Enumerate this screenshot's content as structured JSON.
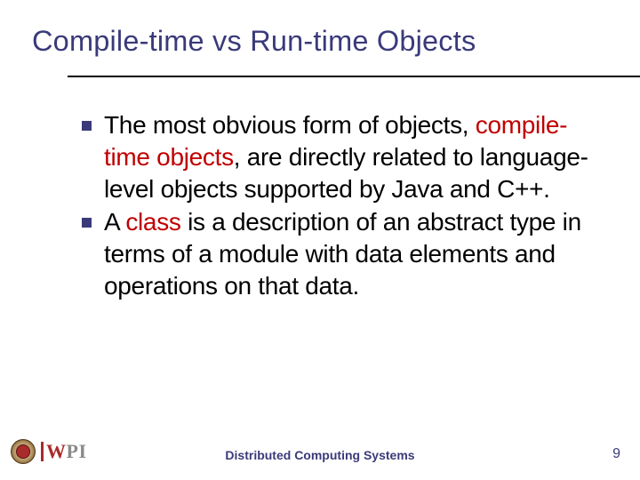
{
  "title": "Compile-time vs Run-time Objects",
  "bullets": [
    {
      "pre": "The most obvious form of objects, ",
      "hl": "compile-time objects",
      "post": ", are directly related to language-level objects supported by Java and C++."
    },
    {
      "pre": "A ",
      "hl": "class",
      "post": " is a description of an abstract type in terms of a module with data elements and operations on that data."
    }
  ],
  "footer": {
    "course": "Distributed Computing Systems",
    "page": "9",
    "logo_text": {
      "w": "W",
      "p": "P",
      "i": "I"
    }
  }
}
